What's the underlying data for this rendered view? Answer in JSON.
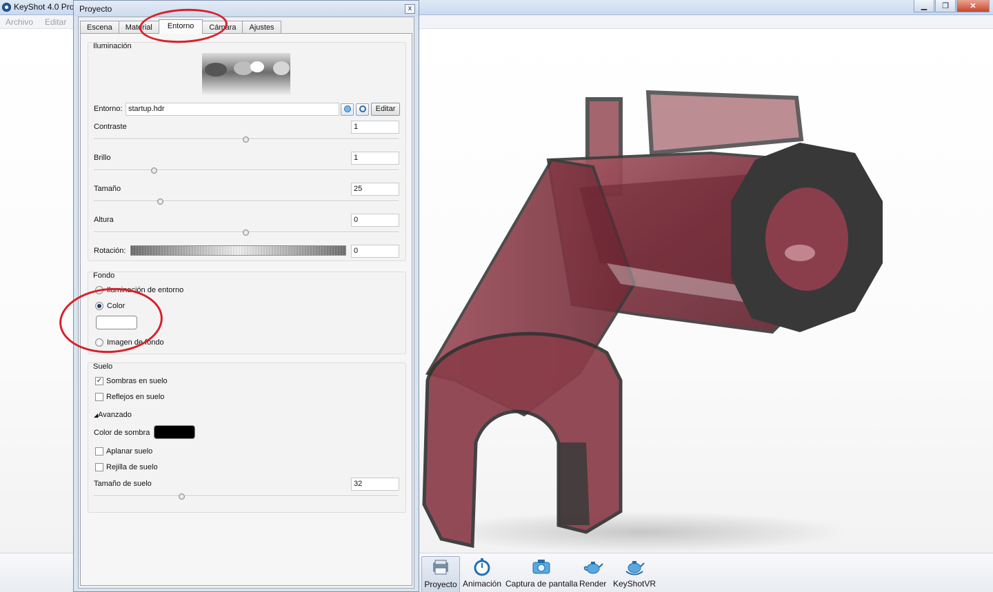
{
  "app": {
    "title": "KeyShot 4.0 Pro",
    "menu": [
      "Archivo",
      "Editar"
    ],
    "window_buttons": {
      "minimize": "▁",
      "maximize": "❐",
      "close": "✕"
    }
  },
  "dialog": {
    "title": "Proyecto",
    "close": "x",
    "tabs": [
      "Escena",
      "Material",
      "Entorno",
      "Cámara",
      "Ajustes"
    ],
    "active_tab": "Entorno",
    "iluminacion": {
      "title": "Iluminación",
      "entorno_label": "Entorno:",
      "entorno_value": "startup.hdr",
      "editar_button": "Editar",
      "contraste": {
        "label": "Contraste",
        "value": "1",
        "slider": 0.5
      },
      "brillo": {
        "label": "Brillo",
        "value": "1",
        "slider": 0.2
      },
      "tamano": {
        "label": "Tamaño",
        "value": "25",
        "slider": 0.22
      },
      "altura": {
        "label": "Altura",
        "value": "0",
        "slider": 0.5
      },
      "rotacion": {
        "label": "Rotación:",
        "value": "0"
      }
    },
    "fondo": {
      "title": "Fondo",
      "options": [
        "Iluminación de entorno",
        "Color",
        "Imagen de fondo"
      ],
      "selected": "Color",
      "color_hex": "#ffffff"
    },
    "suelo": {
      "title": "Suelo",
      "sombras": {
        "label": "Sombras en suelo",
        "checked": true
      },
      "reflejos": {
        "label": "Reflejos en suelo",
        "checked": false
      },
      "avanzado": "Avanzado",
      "color_sombra_label": "Color de sombra",
      "color_sombra_hex": "#000000",
      "aplanar": {
        "label": "Aplanar suelo",
        "checked": false
      },
      "rejilla": {
        "label": "Rejilla de suelo",
        "checked": false
      },
      "tamano_suelo": {
        "label": "Tamaño de suelo",
        "value": "32",
        "slider": 0.29
      }
    }
  },
  "toolbar": [
    {
      "label": "Proyecto",
      "icon": "project-icon",
      "active": true
    },
    {
      "label": "Animación",
      "icon": "stopwatch-icon",
      "active": false
    },
    {
      "label": "Captura de pantalla",
      "icon": "camera-icon",
      "active": false
    },
    {
      "label": "Render",
      "icon": "teapot-icon",
      "active": false
    },
    {
      "label": "KeyShotVR",
      "icon": "teapot-vr-icon",
      "active": false
    }
  ],
  "colors": {
    "annotation": "#d8202a",
    "model": "#8a3b45"
  }
}
